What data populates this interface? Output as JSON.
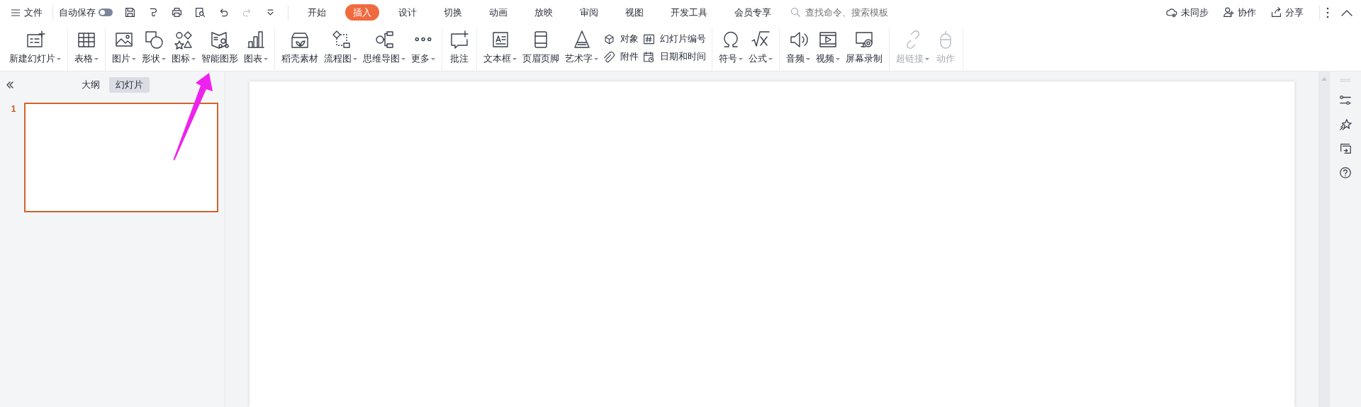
{
  "menu": {
    "label": "文件"
  },
  "autosave": {
    "label": "自动保存",
    "on": false
  },
  "tabs": [
    {
      "label": "开始",
      "selected": false
    },
    {
      "label": "插入",
      "selected": true
    },
    {
      "label": "设计",
      "selected": false
    },
    {
      "label": "切换",
      "selected": false
    },
    {
      "label": "动画",
      "selected": false
    },
    {
      "label": "放映",
      "selected": false
    },
    {
      "label": "审阅",
      "selected": false
    },
    {
      "label": "视图",
      "selected": false
    },
    {
      "label": "开发工具",
      "selected": false
    },
    {
      "label": "会员专享",
      "selected": false
    }
  ],
  "search": {
    "placeholder": "查找命令、搜索模板"
  },
  "actions": [
    {
      "label": "未同步"
    },
    {
      "label": "协作"
    },
    {
      "label": "分享"
    }
  ],
  "ribbon": [
    [
      {
        "kind": "large",
        "label": "新建幻灯片",
        "dropdown": true,
        "disabled": false
      }
    ],
    [
      {
        "kind": "large",
        "label": "表格",
        "dropdown": true,
        "disabled": false
      }
    ],
    [
      {
        "kind": "large",
        "label": "图片",
        "dropdown": true,
        "disabled": false
      },
      {
        "kind": "large",
        "label": "形状",
        "dropdown": true,
        "disabled": false
      },
      {
        "kind": "large",
        "label": "图标",
        "dropdown": true,
        "disabled": false
      },
      {
        "kind": "large",
        "label": "智能图形",
        "dropdown": false,
        "disabled": false
      },
      {
        "kind": "large",
        "label": "图表",
        "dropdown": true,
        "disabled": false
      }
    ],
    [
      {
        "kind": "large",
        "label": "稻壳素材",
        "dropdown": false,
        "disabled": false
      },
      {
        "kind": "large",
        "label": "流程图",
        "dropdown": true,
        "disabled": false
      },
      {
        "kind": "large",
        "label": "思维导图",
        "dropdown": true,
        "disabled": false
      },
      {
        "kind": "large",
        "label": "更多",
        "dropdown": true,
        "disabled": false
      }
    ],
    [
      {
        "kind": "large",
        "label": "批注",
        "dropdown": false,
        "disabled": false
      }
    ],
    [
      {
        "kind": "large",
        "label": "文本框",
        "dropdown": true,
        "disabled": false
      },
      {
        "kind": "large",
        "label": "页眉页脚",
        "dropdown": false,
        "disabled": false
      },
      {
        "kind": "large",
        "label": "艺术字",
        "dropdown": true,
        "disabled": false
      },
      {
        "kind": "small",
        "label": "对象",
        "dropdown": false,
        "disabled": false
      },
      {
        "kind": "small",
        "label": "附件",
        "dropdown": false,
        "disabled": false
      },
      {
        "kind": "small",
        "label": "幻灯片编号",
        "dropdown": false,
        "disabled": false
      },
      {
        "kind": "small",
        "label": "日期和时间",
        "dropdown": false,
        "disabled": false
      }
    ],
    [
      {
        "kind": "large",
        "label": "符号",
        "dropdown": true,
        "disabled": false
      },
      {
        "kind": "large",
        "label": "公式",
        "dropdown": true,
        "disabled": false
      }
    ],
    [
      {
        "kind": "large",
        "label": "音频",
        "dropdown": true,
        "disabled": false
      },
      {
        "kind": "large",
        "label": "视频",
        "dropdown": true,
        "disabled": false
      },
      {
        "kind": "large",
        "label": "屏幕录制",
        "dropdown": false,
        "disabled": false
      }
    ],
    [
      {
        "kind": "large",
        "label": "超链接",
        "dropdown": true,
        "disabled": true
      },
      {
        "kind": "large",
        "label": "动作",
        "dropdown": false,
        "disabled": true
      }
    ]
  ],
  "panel": {
    "tabs": [
      {
        "label": "大纲",
        "selected": false
      },
      {
        "label": "幻灯片",
        "selected": true
      }
    ],
    "slides": [
      {
        "number": "1",
        "selected": true
      }
    ]
  }
}
